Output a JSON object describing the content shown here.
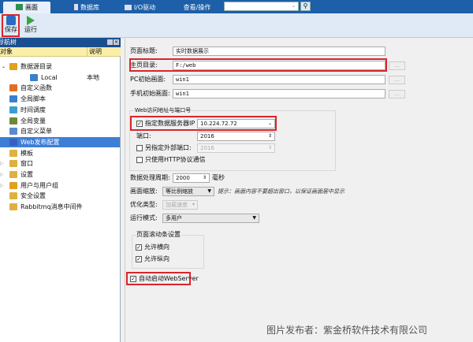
{
  "tabs": [
    {
      "label": "画面",
      "icon": "canvas-icon",
      "active": true
    },
    {
      "label": "数据库",
      "icon": "database-icon"
    },
    {
      "label": "I/O驱动",
      "icon": "io-icon"
    },
    {
      "label": "查看/操作"
    }
  ],
  "search": {
    "value": "",
    "placeholder": ""
  },
  "toolbar": {
    "save": "保存",
    "run": "运行"
  },
  "nav": {
    "title": "导航树",
    "col_object": "对象",
    "col_desc": "说明",
    "items": [
      {
        "label": "数据源目录",
        "desc": ""
      },
      {
        "label": "Local",
        "desc": "本地"
      },
      {
        "label": "自定义函数"
      },
      {
        "label": "全局脚本"
      },
      {
        "label": "时间调度"
      },
      {
        "label": "全局变量"
      },
      {
        "label": "自定义菜单"
      },
      {
        "label": "Web发布配置",
        "selected": true
      },
      {
        "label": "模板"
      },
      {
        "label": "窗口"
      },
      {
        "label": "设置"
      },
      {
        "label": "用户与用户组"
      },
      {
        "label": "安全设置"
      },
      {
        "label": "Rabbitmq消息中间件"
      }
    ]
  },
  "form": {
    "page_title_label": "页面标题:",
    "page_title": "实时数据展示",
    "home_dir_label": "主页目录:",
    "home_dir": "F:/web",
    "pc_label": "PC初始画面:",
    "pc": "win1",
    "mobile_label": "手机初始画面:",
    "mobile": "win1",
    "browse": "...",
    "web_group": "Web访问地址与端口号",
    "server_ip_label": "指定数据服务器IP",
    "server_ip": "10.224.72.72",
    "server_ip_checked": true,
    "port_label": "端口:",
    "port": "2016",
    "ext_port_label": "另指定外部端口:",
    "ext_port": "2016",
    "ext_port_checked": false,
    "http_only_label": "只使用HTTP协议通信",
    "http_only_checked": false,
    "cycle_label": "数据处理周期:",
    "cycle": "2000",
    "cycle_unit": "毫秒",
    "scale_label": "画面缩放:",
    "scale": "等比例缩放",
    "scale_hint": "提示：画面内容不要超出窗口，以保证画面居中显示",
    "opt_label": "优化类型:",
    "opt": "加载速度",
    "mode_label": "运行模式:",
    "mode": "多用户",
    "scroll_group": "页面滚动条设置",
    "scroll_h": "允许横向",
    "scroll_h_checked": true,
    "scroll_v": "允许纵向",
    "scroll_v_checked": true,
    "autostart": "自动启动WebServer",
    "autostart_checked": true
  },
  "watermark": "图片发布者：紫金桥软件技术有限公司",
  "colors": {
    "highlight": "#d9262c",
    "tabbar": "#1d5fa8",
    "selected": "#3d7fd6"
  }
}
